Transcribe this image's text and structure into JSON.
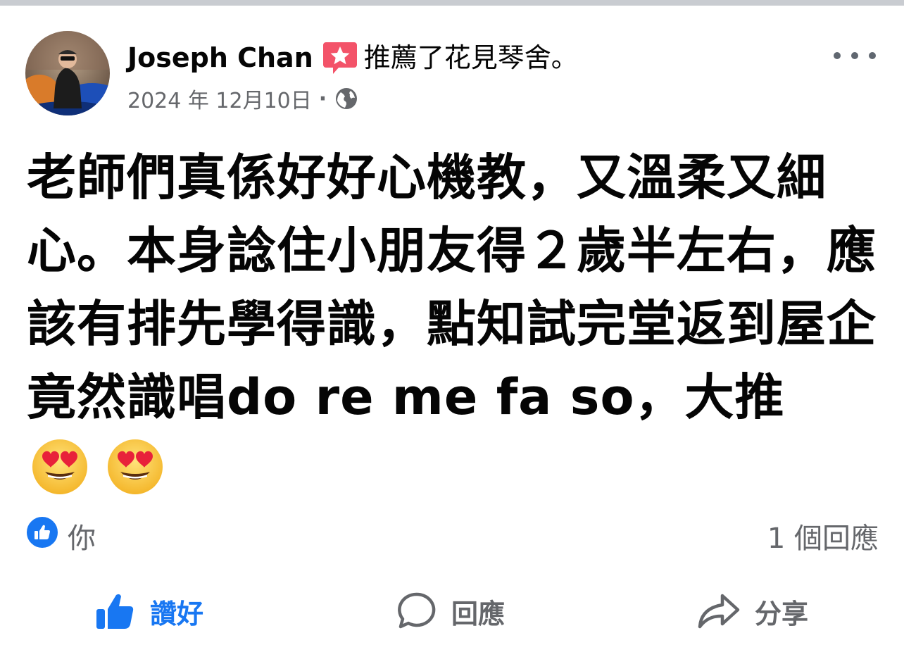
{
  "post": {
    "author_name": "Joseph Chan",
    "action_text": "推薦了",
    "page_name": "花見琴舍。",
    "date": "2024 年 12月10日",
    "separator": "·",
    "privacy_icon": "globe-icon",
    "recommend_icon": "recommend-star-icon",
    "body": "老師們真係好好心機教，又溫柔又細心。本身諗住小朋友得２歲半左右，應該有排先學得識，點知試完堂返到屋企竟然識唱do re me fa so，大推",
    "emojis": [
      "heart-eyes-emoji",
      "heart-eyes-emoji"
    ]
  },
  "reactions": {
    "reaction_icon": "like-icon",
    "reactors_text": "你",
    "comment_count_text": "1 個回應"
  },
  "actions": {
    "like_label": "讚好",
    "comment_label": "回應",
    "share_label": "分享"
  },
  "colors": {
    "brand_blue": "#1877f2",
    "text_primary": "#050505",
    "text_secondary": "#65676b",
    "recommend_red": "#f35369"
  }
}
